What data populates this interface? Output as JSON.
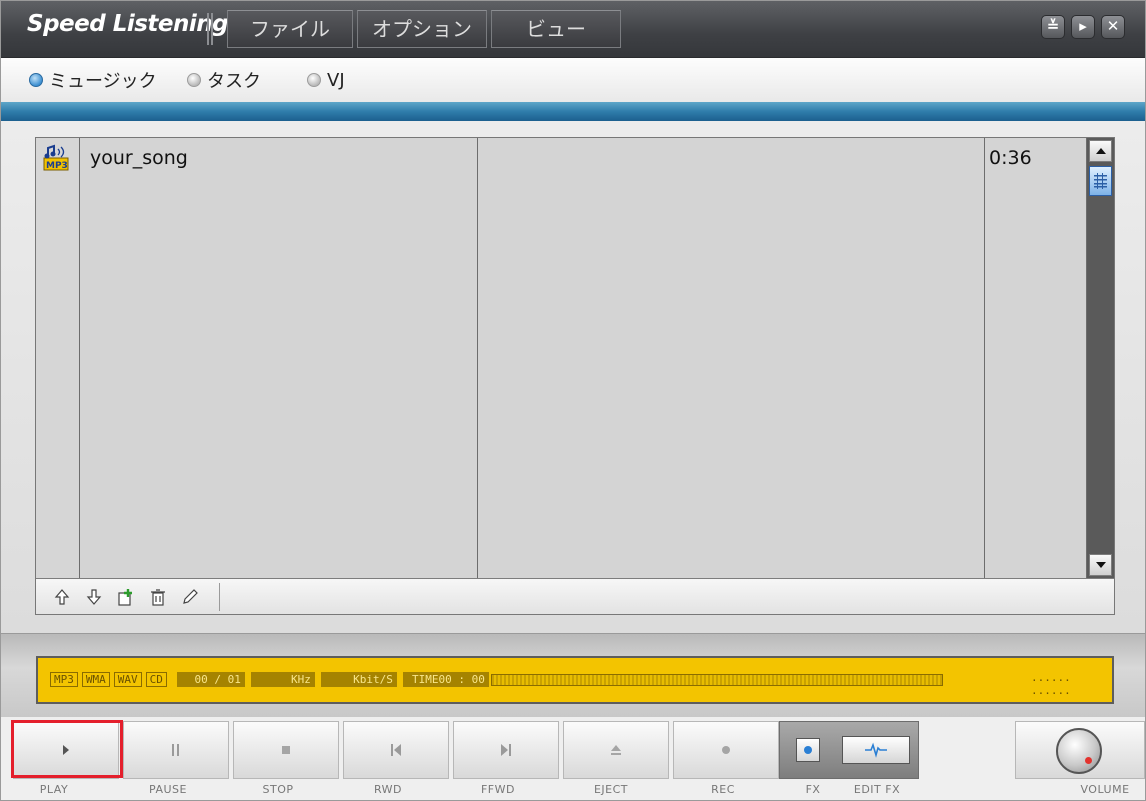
{
  "app": {
    "title": "Speed Listening"
  },
  "menu": [
    {
      "label": "ファイル"
    },
    {
      "label": "オプション"
    },
    {
      "label": "ビュー"
    }
  ],
  "window_controls": [
    {
      "name": "minimize",
      "glyph": "≚"
    },
    {
      "name": "next",
      "glyph": "▸"
    },
    {
      "name": "close",
      "glyph": "✕"
    }
  ],
  "modes": [
    {
      "label": "ミュージック",
      "selected": true
    },
    {
      "label": "タスク",
      "selected": false
    },
    {
      "label": "VJ",
      "selected": false
    }
  ],
  "playlist": {
    "items": [
      {
        "icon": "mp3-file-icon",
        "name": "your_song",
        "duration": "0:36"
      }
    ],
    "tools": [
      {
        "name": "move-up-icon"
      },
      {
        "name": "move-down-icon"
      },
      {
        "name": "add-file-icon"
      },
      {
        "name": "delete-icon"
      },
      {
        "name": "edit-icon"
      }
    ]
  },
  "display": {
    "formats": [
      "MP3",
      "WMA",
      "WAV",
      "CD"
    ],
    "track": "00 / 01",
    "khz": "KHz",
    "kbps": "Kbit/S",
    "time": "TIME00 : 00",
    "dots": "...... ......"
  },
  "transport": {
    "play": "PLAY",
    "pause": "PAUSE",
    "stop": "STOP",
    "rwd": "RWD",
    "ffwd": "FFWD",
    "eject": "EJECT",
    "rec": "REC",
    "fx": "FX",
    "edit_fx": "EDIT FX",
    "volume": "VOLUME"
  },
  "colors": {
    "accent_stripe": "#2f7dab",
    "lcd": "#f3c400",
    "highlight": "#e41f2c"
  }
}
